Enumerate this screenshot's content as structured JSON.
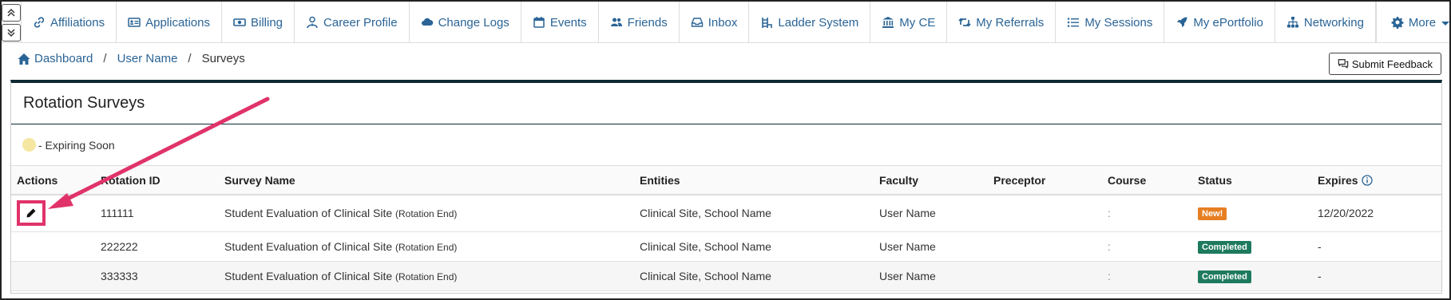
{
  "nav": {
    "items": [
      {
        "label": "Affiliations",
        "icon": "link-icon"
      },
      {
        "label": "Applications",
        "icon": "id-card-icon"
      },
      {
        "label": "Billing",
        "icon": "money-icon"
      },
      {
        "label": "Career Profile",
        "icon": "user-tie-icon"
      },
      {
        "label": "Change Logs",
        "icon": "cloud-icon"
      },
      {
        "label": "Events",
        "icon": "calendar-icon"
      },
      {
        "label": "Friends",
        "icon": "users-icon"
      },
      {
        "label": "Inbox",
        "icon": "inbox-icon"
      },
      {
        "label": "Ladder System",
        "icon": "ladder-icon"
      },
      {
        "label": "My CE",
        "icon": "institution-icon"
      },
      {
        "label": "My Referrals",
        "icon": "retweet-icon"
      },
      {
        "label": "My Sessions",
        "icon": "list-icon"
      },
      {
        "label": "My ePortfolio",
        "icon": "rocket-icon"
      },
      {
        "label": "Networking",
        "icon": "sitemap-icon"
      }
    ],
    "more_label": "More"
  },
  "breadcrumb": {
    "home": "Dashboard",
    "user": "User Name",
    "current": "Surveys",
    "separator": "/"
  },
  "feedback_button": "Submit Feedback",
  "panel": {
    "title": "Rotation Surveys",
    "legend_text": "- Expiring Soon"
  },
  "table": {
    "headers": {
      "actions": "Actions",
      "rotation_id": "Rotation ID",
      "survey_name": "Survey Name",
      "entities": "Entities",
      "faculty": "Faculty",
      "preceptor": "Preceptor",
      "course": "Course",
      "status": "Status",
      "expires": "Expires"
    },
    "rows": [
      {
        "rotation_id": "111111",
        "survey_name": "Student Evaluation of Clinical Site",
        "survey_note": "(Rotation End)",
        "entities": "Clinical Site, School Name",
        "faculty": "User Name",
        "preceptor": "",
        "course": ":",
        "status": "New!",
        "expires": "12/20/2022"
      },
      {
        "rotation_id": "222222",
        "survey_name": "Student Evaluation of Clinical Site",
        "survey_note": "(Rotation End)",
        "entities": "Clinical Site, School Name",
        "faculty": "User Name",
        "preceptor": "",
        "course": ":",
        "status": "Completed",
        "expires": "-"
      },
      {
        "rotation_id": "333333",
        "survey_name": "Student Evaluation of Clinical Site",
        "survey_note": "(Rotation End)",
        "entities": "Clinical Site, School Name",
        "faculty": "User Name",
        "preceptor": "",
        "course": ":",
        "status": "Completed",
        "expires": "-"
      }
    ]
  },
  "colors": {
    "link": "#2a6496",
    "panel_accent": "#0e2a35",
    "badge_new": "#e67e22",
    "badge_completed": "#1e7a5e",
    "annotation": "#e0336a",
    "expiring_dot": "#f5e6a1"
  }
}
